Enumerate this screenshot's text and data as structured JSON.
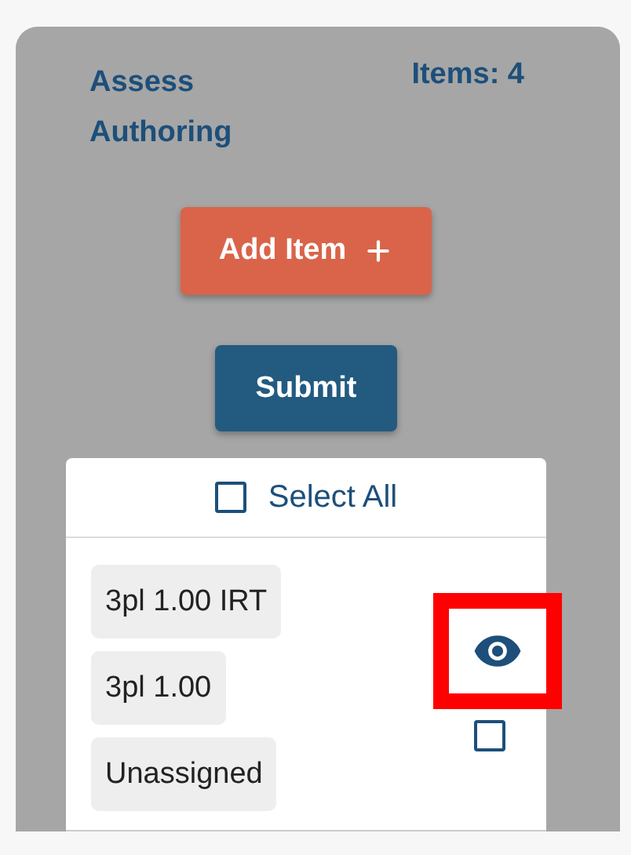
{
  "header": {
    "title": "Assess Authoring",
    "count": "Items: 4"
  },
  "add_button": {
    "label": "Add Item"
  },
  "submit_button": {
    "label": "Submit"
  },
  "select_all": {
    "label": "Select All",
    "checked": false
  },
  "items": [
    {
      "tags": [
        "3pl 1.00 IRT",
        "3pl 1.00",
        "Unassigned"
      ],
      "highlighted": true,
      "checked": false
    }
  ]
}
